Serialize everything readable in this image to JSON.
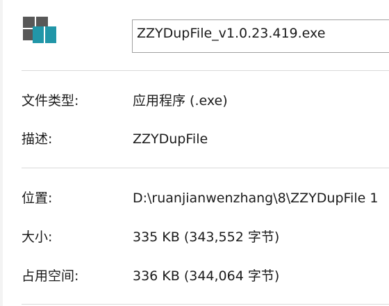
{
  "window": {
    "file_name": "ZZYDupFile_v1.0.23.419.exe",
    "app_icon": "app-window-icon",
    "icon_colors": {
      "dark": "#585858",
      "accent": "#2196a8"
    }
  },
  "general": {
    "type_label": "文件类型:",
    "type_value": "应用程序 (.exe)",
    "description_label": "描述:",
    "description_value": "ZZYDupFile",
    "location_label": "位置:",
    "location_value": "D:\\ruanjianwenzhang\\8\\ZZYDupFile 1",
    "size_label": "大小:",
    "size_value": "335 KB (343,552 字节)",
    "size_on_disk_label": "占用空间:",
    "size_on_disk_value": "336 KB (344,064 字节)"
  }
}
